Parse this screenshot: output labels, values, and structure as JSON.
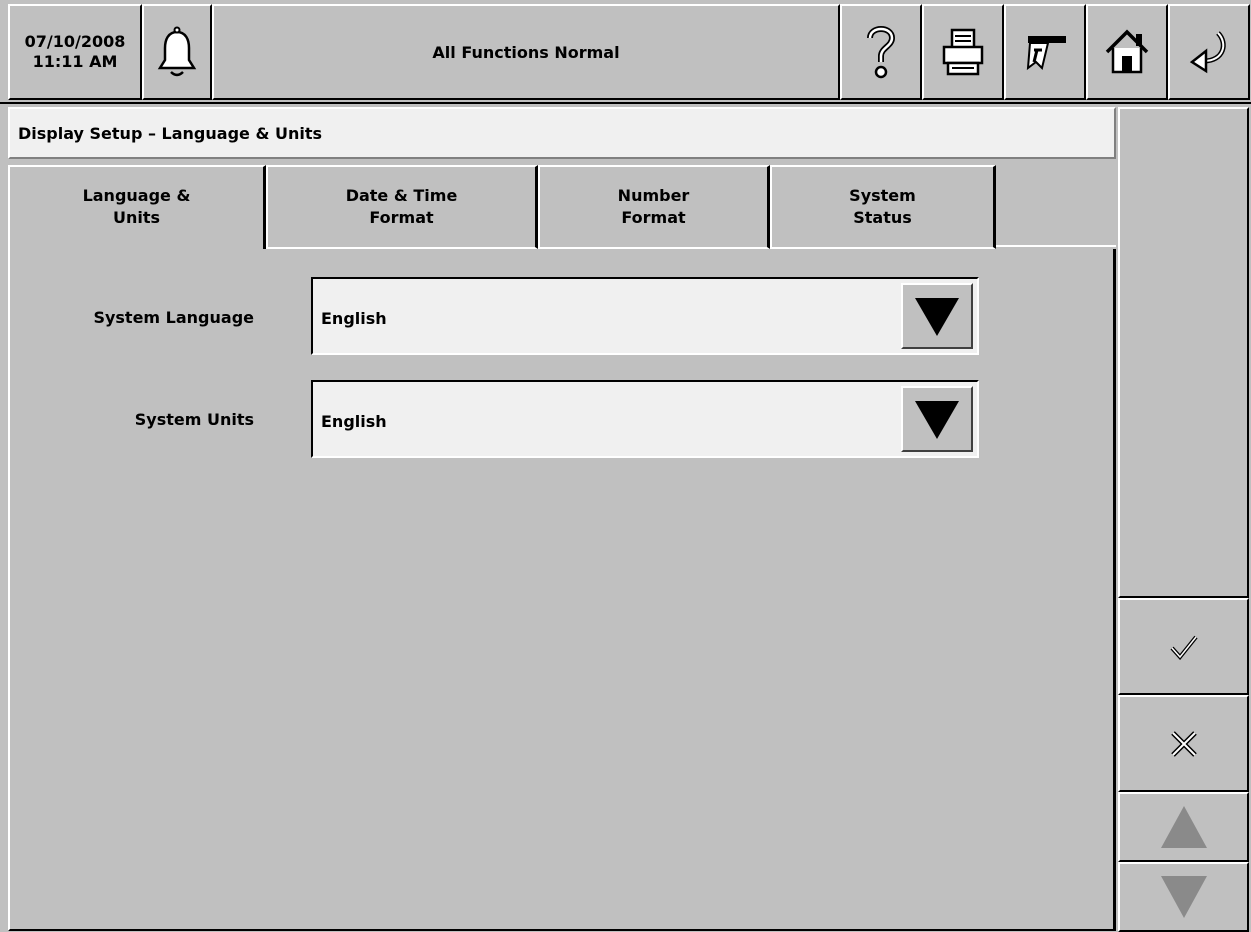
{
  "header": {
    "date": "07/10/2008",
    "time": "11:11 AM",
    "status_text": "All Functions Normal"
  },
  "page": {
    "title": "Display Setup – Language & Units"
  },
  "tabs": [
    {
      "label": "Language &\nUnits",
      "active": true
    },
    {
      "label": "Date & Time\nFormat",
      "active": false
    },
    {
      "label": "Number\nFormat",
      "active": false
    },
    {
      "label": "System\nStatus",
      "active": false
    }
  ],
  "form": {
    "system_language": {
      "label": "System Language",
      "value": "English"
    },
    "system_units": {
      "label": "System Units",
      "value": "English"
    }
  },
  "icons": {
    "alarm": "bell-icon",
    "help": "question-mark-icon",
    "print": "printer-icon",
    "report": "ticket-icon",
    "home": "house-icon",
    "back": "return-arrow-icon",
    "accept": "checkmark-icon",
    "cancel": "x-icon",
    "scroll_up": "up-triangle-icon",
    "scroll_down": "down-triangle-icon"
  },
  "colors": {
    "background": "#c0c0c0",
    "field": "#f0f0f0",
    "disabled_arrow": "#8a8a8a"
  }
}
